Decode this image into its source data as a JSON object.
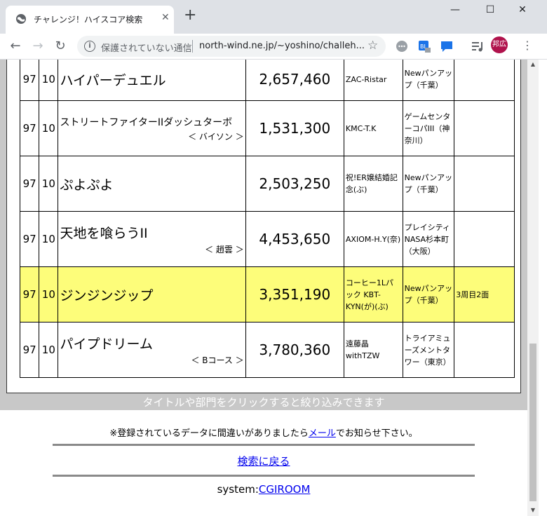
{
  "browser": {
    "tab_title": "チャレンジ！ハイスコア検索",
    "tab_close": "✕",
    "newtab": "+",
    "minimize": "—",
    "maximize": "☐",
    "close": "✕",
    "security_label": "保護されていない通信",
    "url": "north-wind.ne.jp/~yoshino/challeh...",
    "avatar_text": "邦広",
    "accent": "#b0124c"
  },
  "table": {
    "rows": [
      {
        "year": "97",
        "month": "10",
        "game": "ハイパーデュエル",
        "sub": "",
        "score": "2,657,460",
        "player": "ZAC-Ristar",
        "shop": "Newパンアップ（千葉）",
        "note": "",
        "highlight": false
      },
      {
        "year": "97",
        "month": "10",
        "game": "ストリートファイターIIダッシュターボ",
        "sub": "＜ バイソン ＞",
        "score": "1,531,300",
        "player": "KMC-T.K",
        "shop": "ゲームセンターコパIII（神奈川）",
        "note": "",
        "highlight": false
      },
      {
        "year": "97",
        "month": "10",
        "game": "ぷよぷよ",
        "sub": "",
        "score": "2,503,250",
        "player": "祝!ER嬢結婚記念(ぶ)",
        "shop": "Newパンアップ（千葉）",
        "note": "",
        "highlight": false
      },
      {
        "year": "97",
        "month": "10",
        "game": "天地を喰らうII",
        "sub": "＜ 趙雲 ＞",
        "score": "4,453,650",
        "player": "AXIOM-H.Y(奈)",
        "shop": "プレイシティNASA杉本町（大阪）",
        "note": "",
        "highlight": false
      },
      {
        "year": "97",
        "month": "10",
        "game": "ジンジンジップ",
        "sub": "",
        "score": "3,351,190",
        "player": "コーヒー1Lパック KBT-KYN(が)(ぶ)",
        "shop": "Newパンアップ（千葉）",
        "note": "3周目2面",
        "highlight": true
      },
      {
        "year": "97",
        "month": "10",
        "game": "パイプドリーム",
        "sub": "＜ Bコース ＞",
        "score": "3,780,360",
        "player": "遠藤晶 withTZW",
        "shop": "トライアミューズメントタワー（東京）",
        "note": "",
        "highlight": false
      }
    ]
  },
  "footer": {
    "hint": "タイトルや部門をクリックすると絞り込みできます",
    "notice_before": "※登録されているデータに間違いがありましたら",
    "notice_link": "メール",
    "notice_after": "でお知らせ下さい。",
    "back_link": "検索に戻る",
    "system_label": "system:",
    "system_link": "CGIROOM"
  }
}
